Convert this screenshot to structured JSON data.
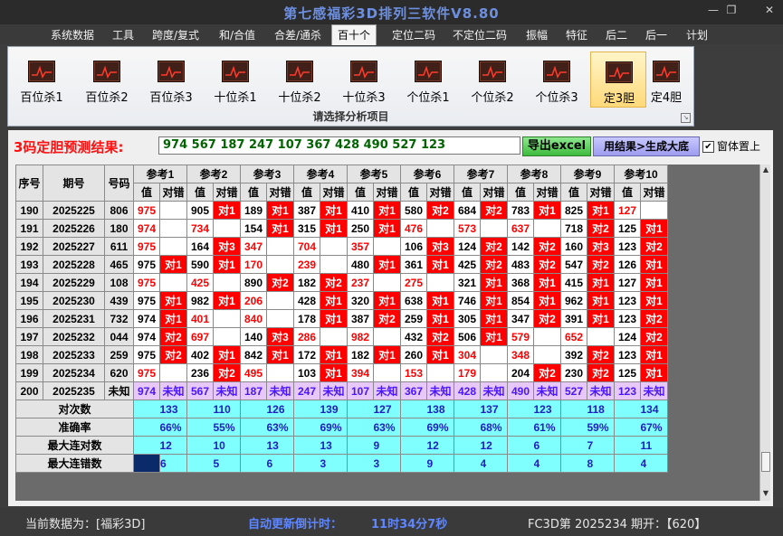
{
  "window": {
    "title": "第七感福彩3D排列三软件V8.80",
    "minimize": "—",
    "restore": "❐",
    "close": "✕"
  },
  "menu": [
    "系统数据",
    "工具",
    "跨度/复式",
    "和/合值",
    "合差/通杀",
    "百十个",
    "定位二码",
    "不定位二码",
    "振幅",
    "特征",
    "后二",
    "后一",
    "计划"
  ],
  "active_menu_index": 5,
  "ribbon": {
    "buttons": [
      "百位杀1",
      "百位杀2",
      "百位杀3",
      "十位杀1",
      "十位杀2",
      "十位杀3",
      "个位杀1",
      "个位杀2",
      "个位杀3",
      "定3胆",
      "定4胆"
    ],
    "active_index": 9,
    "caption": "请选择分析项目"
  },
  "prediction": {
    "label": "3码定胆预测结果:",
    "value": "974 567 187 247 107 367 428 490 527 123",
    "excel_button": "导出excel",
    "generate_button": "用结果>生成大底",
    "topmost_label": "窗体置上",
    "topmost_checked": "✔"
  },
  "grid": {
    "col_headers": {
      "seq": "序号",
      "period": "期号",
      "code": "号码",
      "value": "值",
      "hit": "对错"
    },
    "refs": [
      "参考1",
      "参考2",
      "参考3",
      "参考4",
      "参考5",
      "参考6",
      "参考7",
      "参考8",
      "参考9",
      "参考10"
    ],
    "rows": [
      {
        "seq": "190",
        "period": "2025225",
        "code": "806",
        "vals": [
          "975",
          "905",
          "189",
          "387",
          "410",
          "580",
          "684",
          "783",
          "825",
          "127"
        ],
        "hits": [
          "",
          "对1",
          "对1",
          "对1",
          "对1",
          "对2",
          "对2",
          "对1",
          "对1",
          ""
        ]
      },
      {
        "seq": "191",
        "period": "2025226",
        "code": "180",
        "vals": [
          "974",
          "734",
          "154",
          "315",
          "250",
          "476",
          "573",
          "637",
          "718",
          "125"
        ],
        "hits": [
          "",
          "",
          "对1",
          "对1",
          "对1",
          "",
          "",
          "",
          "对2",
          "对1"
        ]
      },
      {
        "seq": "192",
        "period": "2025227",
        "code": "611",
        "vals": [
          "975",
          "164",
          "347",
          "704",
          "357",
          "106",
          "124",
          "142",
          "160",
          "123"
        ],
        "hits": [
          "",
          "对3",
          "",
          "",
          "",
          "对3",
          "对2",
          "对2",
          "对3",
          "对2"
        ]
      },
      {
        "seq": "193",
        "period": "2025228",
        "code": "465",
        "vals": [
          "975",
          "590",
          "170",
          "239",
          "480",
          "361",
          "425",
          "483",
          "547",
          "126"
        ],
        "hits": [
          "对1",
          "对1",
          "",
          "",
          "对1",
          "对1",
          "对2",
          "对2",
          "对2",
          "对1"
        ]
      },
      {
        "seq": "194",
        "period": "2025229",
        "code": "108",
        "vals": [
          "975",
          "425",
          "890",
          "182",
          "237",
          "275",
          "321",
          "368",
          "415",
          "127"
        ],
        "hits": [
          "",
          "",
          "对2",
          "对2",
          "",
          "",
          "对1",
          "对1",
          "对1",
          "对1"
        ]
      },
      {
        "seq": "195",
        "period": "2025230",
        "code": "439",
        "vals": [
          "975",
          "982",
          "206",
          "428",
          "320",
          "638",
          "746",
          "854",
          "962",
          "123"
        ],
        "hits": [
          "对1",
          "对1",
          "",
          "对1",
          "对1",
          "对1",
          "对1",
          "对1",
          "对1",
          "对1"
        ]
      },
      {
        "seq": "196",
        "period": "2025231",
        "code": "732",
        "vals": [
          "974",
          "401",
          "840",
          "178",
          "387",
          "259",
          "305",
          "347",
          "391",
          "123"
        ],
        "hits": [
          "对1",
          "",
          "",
          "对1",
          "对2",
          "对1",
          "对1",
          "对2",
          "对1",
          "对2"
        ]
      },
      {
        "seq": "197",
        "period": "2025232",
        "code": "044",
        "vals": [
          "974",
          "697",
          "140",
          "286",
          "982",
          "432",
          "506",
          "579",
          "652",
          "124"
        ],
        "hits": [
          "对2",
          "",
          "对3",
          "",
          "",
          "对2",
          "对1",
          "",
          "",
          "对2"
        ]
      },
      {
        "seq": "198",
        "period": "2025233",
        "code": "259",
        "vals": [
          "975",
          "402",
          "842",
          "172",
          "182",
          "260",
          "304",
          "348",
          "392",
          "123"
        ],
        "hits": [
          "对2",
          "对1",
          "对1",
          "对1",
          "对1",
          "对1",
          "",
          "",
          "对2",
          "对1"
        ]
      },
      {
        "seq": "199",
        "period": "2025234",
        "code": "620",
        "vals": [
          "975",
          "236",
          "495",
          "103",
          "394",
          "153",
          "179",
          "204",
          "230",
          "125"
        ],
        "hits": [
          "",
          "对2",
          "",
          "对1",
          "",
          "",
          "",
          "对2",
          "对2",
          "对1"
        ]
      }
    ],
    "pending": {
      "seq": "200",
      "period": "2025235",
      "code": "未知",
      "vals": [
        "974",
        "567",
        "187",
        "247",
        "107",
        "367",
        "428",
        "490",
        "527",
        "123"
      ],
      "hit": "未知"
    },
    "stats": [
      {
        "label": "对次数",
        "values": [
          "133",
          "110",
          "126",
          "139",
          "127",
          "138",
          "137",
          "123",
          "118",
          "134"
        ]
      },
      {
        "label": "准确率",
        "values": [
          "66%",
          "55%",
          "63%",
          "69%",
          "63%",
          "69%",
          "68%",
          "61%",
          "59%",
          "67%"
        ]
      },
      {
        "label": "最大连对数",
        "values": [
          "12",
          "10",
          "13",
          "13",
          "9",
          "12",
          "12",
          "6",
          "7",
          "11"
        ]
      },
      {
        "label": "最大连错数",
        "values": [
          "6",
          "5",
          "6",
          "3",
          "3",
          "9",
          "4",
          "4",
          "8",
          "4"
        ]
      }
    ]
  },
  "status": {
    "current_data": "当前数据为：[福彩3D]",
    "countdown_label": "自动更新倒计时：",
    "countdown_value": "11时34分7秒",
    "period_info": "FC3D第 2025234 期开：【620】"
  },
  "colors": {
    "hit_mark": "#ff0000",
    "stat_bg": "#80ffff",
    "pending_bg": "#e8c8f8",
    "title": "#6d8fe0",
    "countdown": "#5e86ff"
  }
}
